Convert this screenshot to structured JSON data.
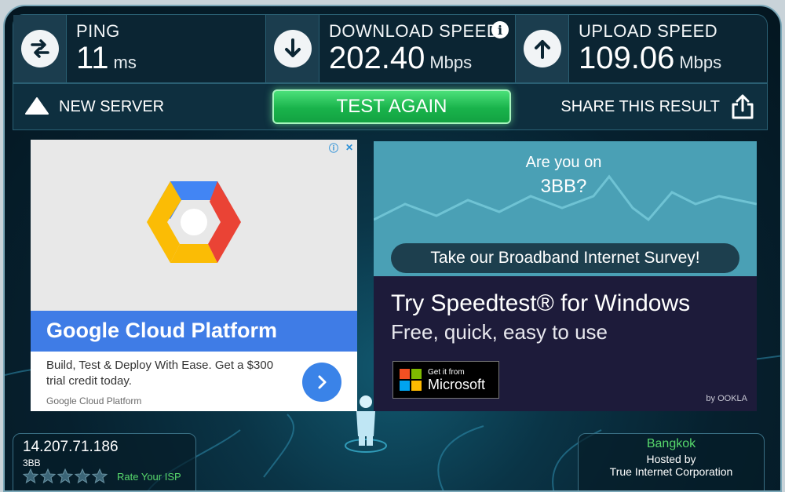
{
  "stats": {
    "ping": {
      "label": "PING",
      "value": "11",
      "unit": "ms"
    },
    "download": {
      "label": "DOWNLOAD SPEED",
      "value": "202.40",
      "unit": "Mbps"
    },
    "upload": {
      "label": "UPLOAD SPEED",
      "value": "109.06",
      "unit": "Mbps"
    }
  },
  "actions": {
    "new_server": "NEW SERVER",
    "test_again": "TEST AGAIN",
    "share": "SHARE THIS RESULT"
  },
  "ad_google": {
    "title": "Google Cloud Platform",
    "description": "Build, Test & Deploy With Ease. Get a $300 trial credit today.",
    "source": "Google Cloud Platform"
  },
  "ad_survey": {
    "line1": "Are you on",
    "line2": "3BB?",
    "cta": "Take our Broadband Internet Survey!"
  },
  "ad_windows": {
    "title": "Try Speedtest® for Windows",
    "subtitle": "Free, quick, easy to use",
    "badge_small": "Get it from",
    "badge_big": "Microsoft",
    "by": "by OOKLA"
  },
  "client": {
    "ip": "14.207.71.186",
    "isp": "3BB",
    "rate": "Rate Your ISP",
    "stars": 0
  },
  "server": {
    "city": "Bangkok",
    "hosted_by": "Hosted by",
    "host": "True Internet Corporation"
  },
  "colors": {
    "accent_green": "#19b34b",
    "frame_dark": "#06202e",
    "google_blue": "#3f7ce6",
    "survey_teal": "#4aa0b5",
    "windows_navy": "#1d1b3a"
  }
}
